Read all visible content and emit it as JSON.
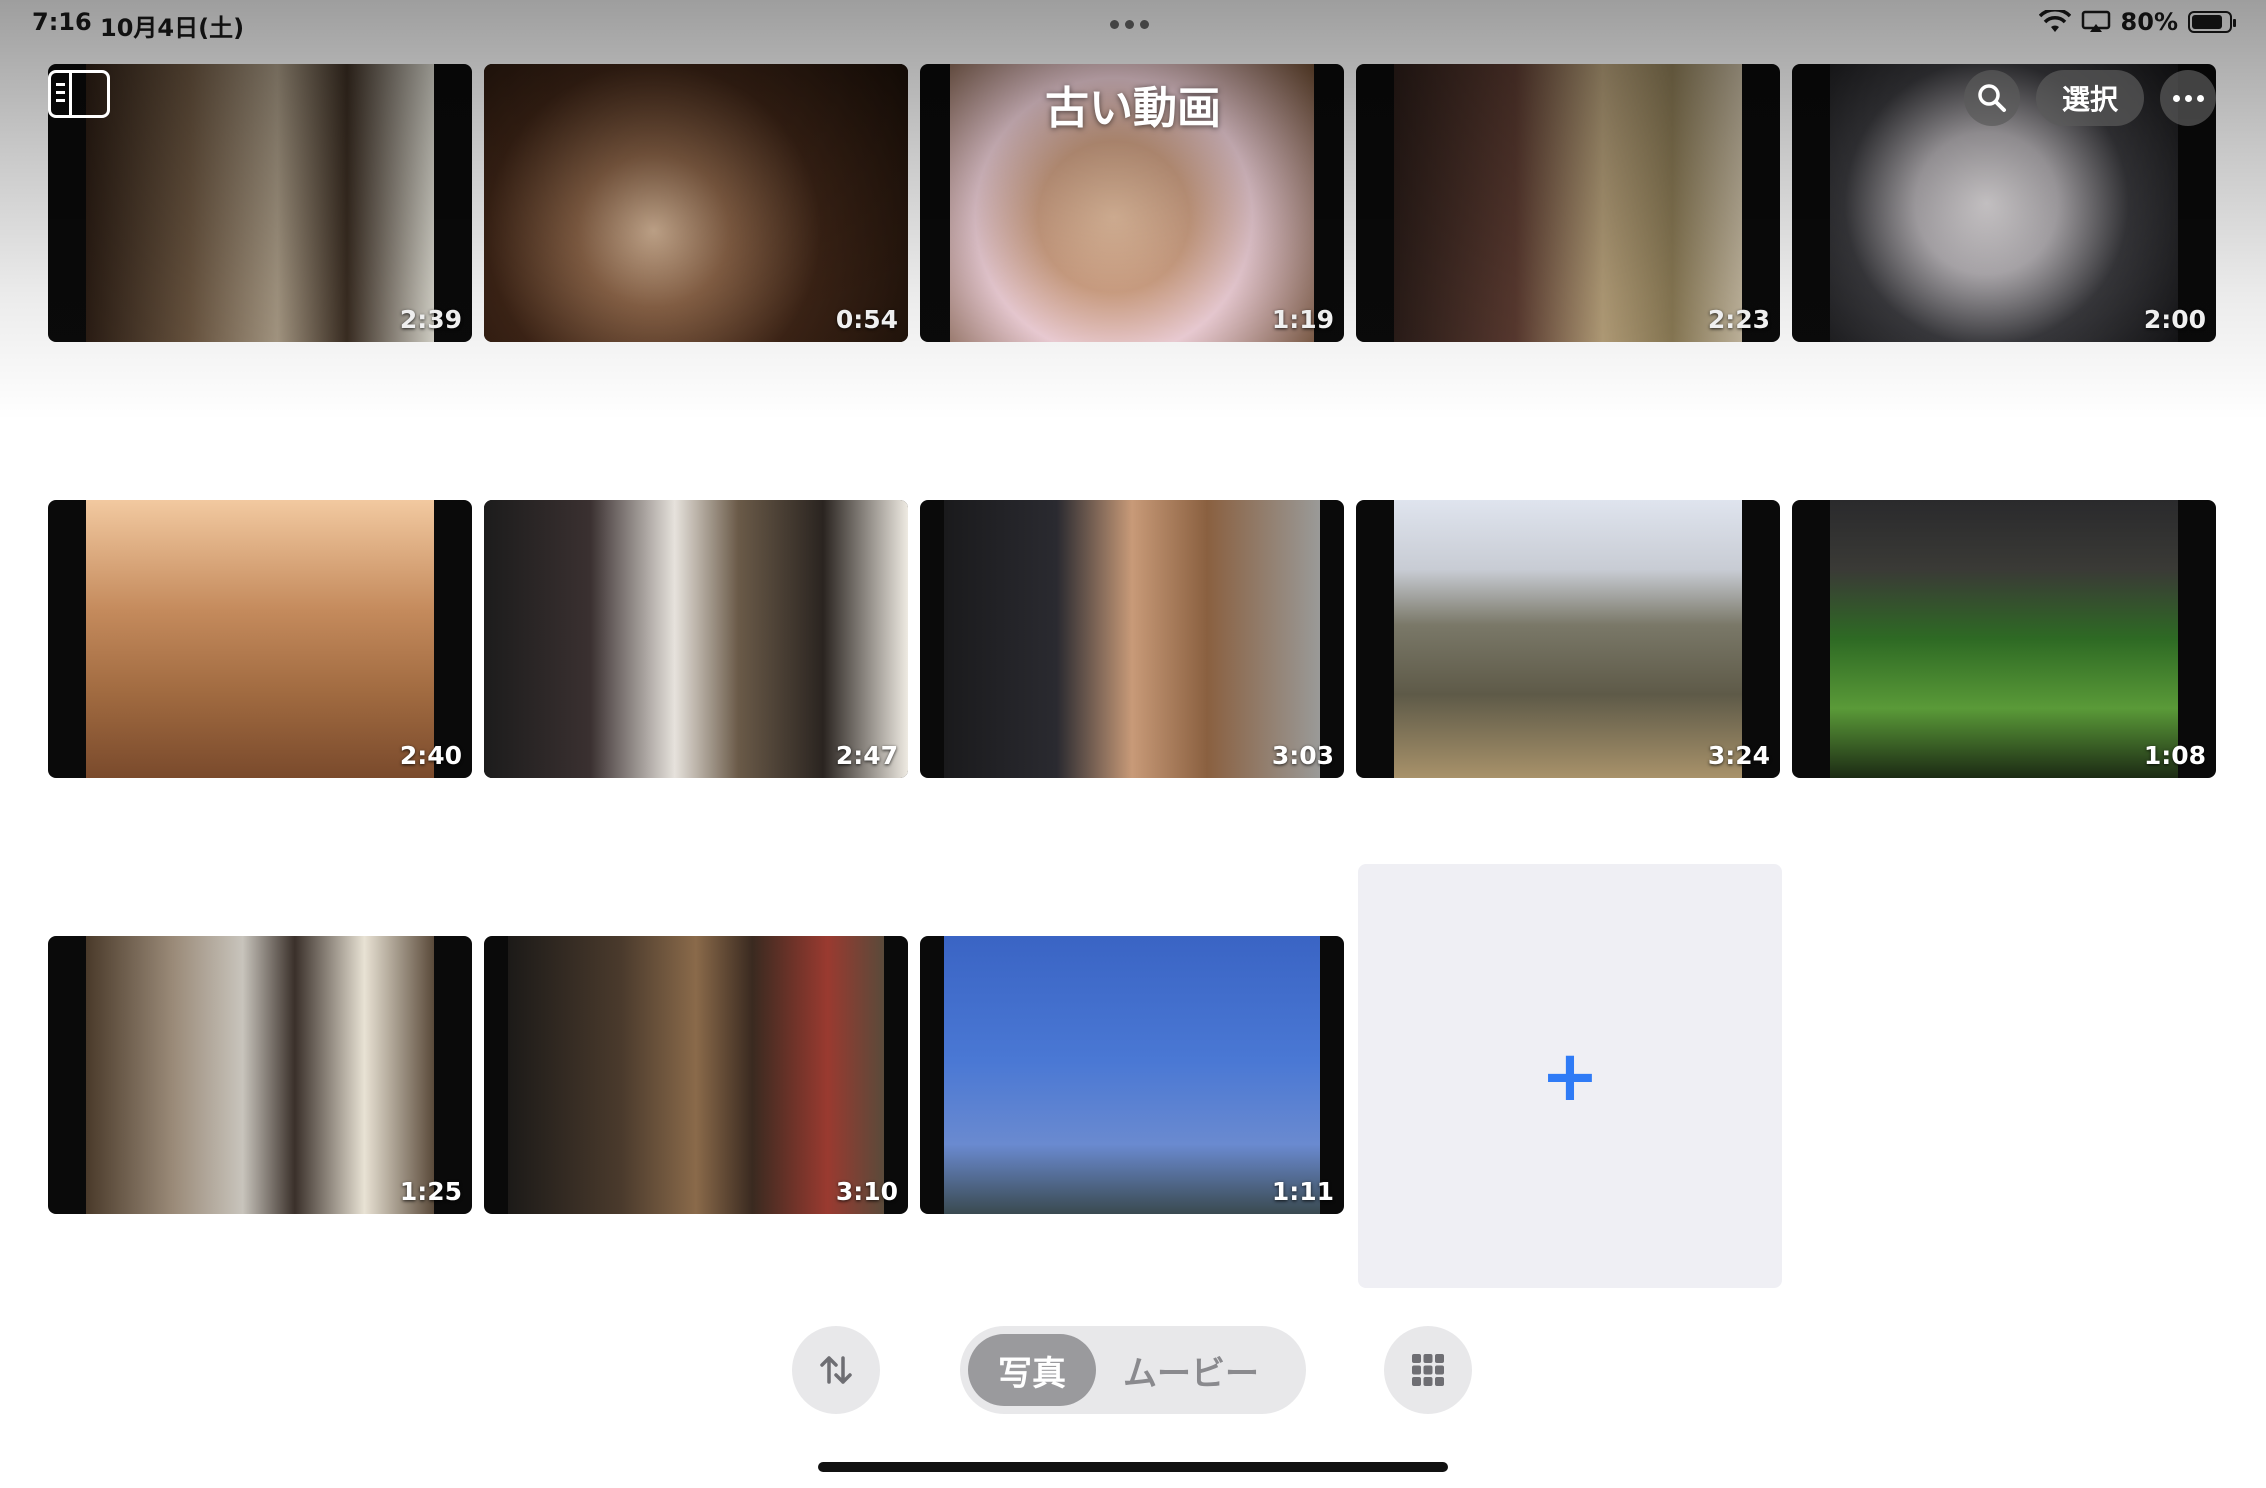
{
  "status_bar": {
    "time": "7:16",
    "date": "10月4日(土)",
    "battery": "80%",
    "battery_level": 0.8
  },
  "header": {
    "album_title": "古い動画",
    "select_label": "選択"
  },
  "icons": {
    "sidebar": "sidebar-icon",
    "search": "search-icon",
    "more": "ellipsis-icon",
    "sort": "sort-arrows-icon",
    "grid": "grid-icon",
    "add": "plus-icon"
  },
  "videos": [
    {
      "duration": "2:39"
    },
    {
      "duration": "0:54"
    },
    {
      "duration": "1:19"
    },
    {
      "duration": "2:23"
    },
    {
      "duration": "2:00"
    },
    {
      "duration": "2:40"
    },
    {
      "duration": "2:47"
    },
    {
      "duration": "3:03"
    },
    {
      "duration": "3:24"
    },
    {
      "duration": "1:08"
    },
    {
      "duration": "1:25"
    },
    {
      "duration": "3:10"
    },
    {
      "duration": "1:11"
    }
  ],
  "add_tile": {
    "label": "+"
  },
  "segmented": {
    "photos": "写真",
    "movies": "ムービー",
    "selected": "写真"
  },
  "colors": {
    "accent": "#2f7bf6"
  }
}
